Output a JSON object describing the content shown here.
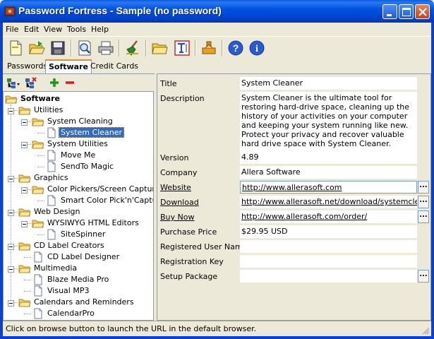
{
  "window": {
    "title": "Password Fortress - Sample (no password)"
  },
  "menu": [
    "File",
    "Edit",
    "View",
    "Tools",
    "Help"
  ],
  "toolbar": {
    "buttons": [
      "new-icon",
      "open-icon",
      "save-icon",
      "preview-icon",
      "print-icon",
      "clean-icon",
      "folder-icon",
      "text-icon",
      "plugin-icon",
      "help-icon",
      "info-icon"
    ]
  },
  "tabs": [
    "Passwords",
    "Software",
    "Credit Cards"
  ],
  "active_tab": "Software",
  "tree": {
    "root": "Software",
    "nodes": [
      {
        "label": "Utilities"
      },
      {
        "label": "System Cleaning"
      },
      {
        "label": "System Cleaner"
      },
      {
        "label": "System Utilities"
      },
      {
        "label": "Move Me"
      },
      {
        "label": "SendTo Magic"
      },
      {
        "label": "Graphics"
      },
      {
        "label": "Color Pickers/Screen Capture"
      },
      {
        "label": "Smart Color Pick'n'Capture"
      },
      {
        "label": "Web Design"
      },
      {
        "label": "WYSIWYG HTML Editors"
      },
      {
        "label": "SiteSpinner"
      },
      {
        "label": "CD Label Creators"
      },
      {
        "label": "CD Label Designer"
      },
      {
        "label": "Multimedia"
      },
      {
        "label": "Blaze Media Pro"
      },
      {
        "label": "Visual MP3"
      },
      {
        "label": "Calendars and Reminders"
      },
      {
        "label": "CalendarPro"
      }
    ]
  },
  "fields": {
    "title_label": "Title",
    "title_value": "System Cleaner",
    "description_label": "Description",
    "description_value": "System Cleaner is the ultimate tool for restoring hard-drive space, cleaning up the history of your activities on your computer and keeping your system running like new. Protect your privacy and recover valuable hard drive space with System Cleaner.",
    "version_label": "Version",
    "version_value": "4.89",
    "company_label": "Company",
    "company_value": "Allera Software",
    "website_label": "Website",
    "website_value": "http://www.allerasoft.com",
    "download_label": "Download",
    "download_value": "http://www.allerasoft.net/download/systemcleaner",
    "buynow_label": "Buy Now",
    "buynow_value": "http://www.allerasoft.com/order/",
    "price_label": "Purchase Price",
    "price_value": "$29.95 USD",
    "reguser_label": "Registered User Name",
    "reguser_value": "",
    "regkey_label": "Registration Key",
    "regkey_value": "",
    "setup_label": "Setup Package",
    "setup_value": "",
    "browse_label": "..."
  },
  "status": {
    "text": "Click on browse button to launch the URL in the default browser."
  }
}
